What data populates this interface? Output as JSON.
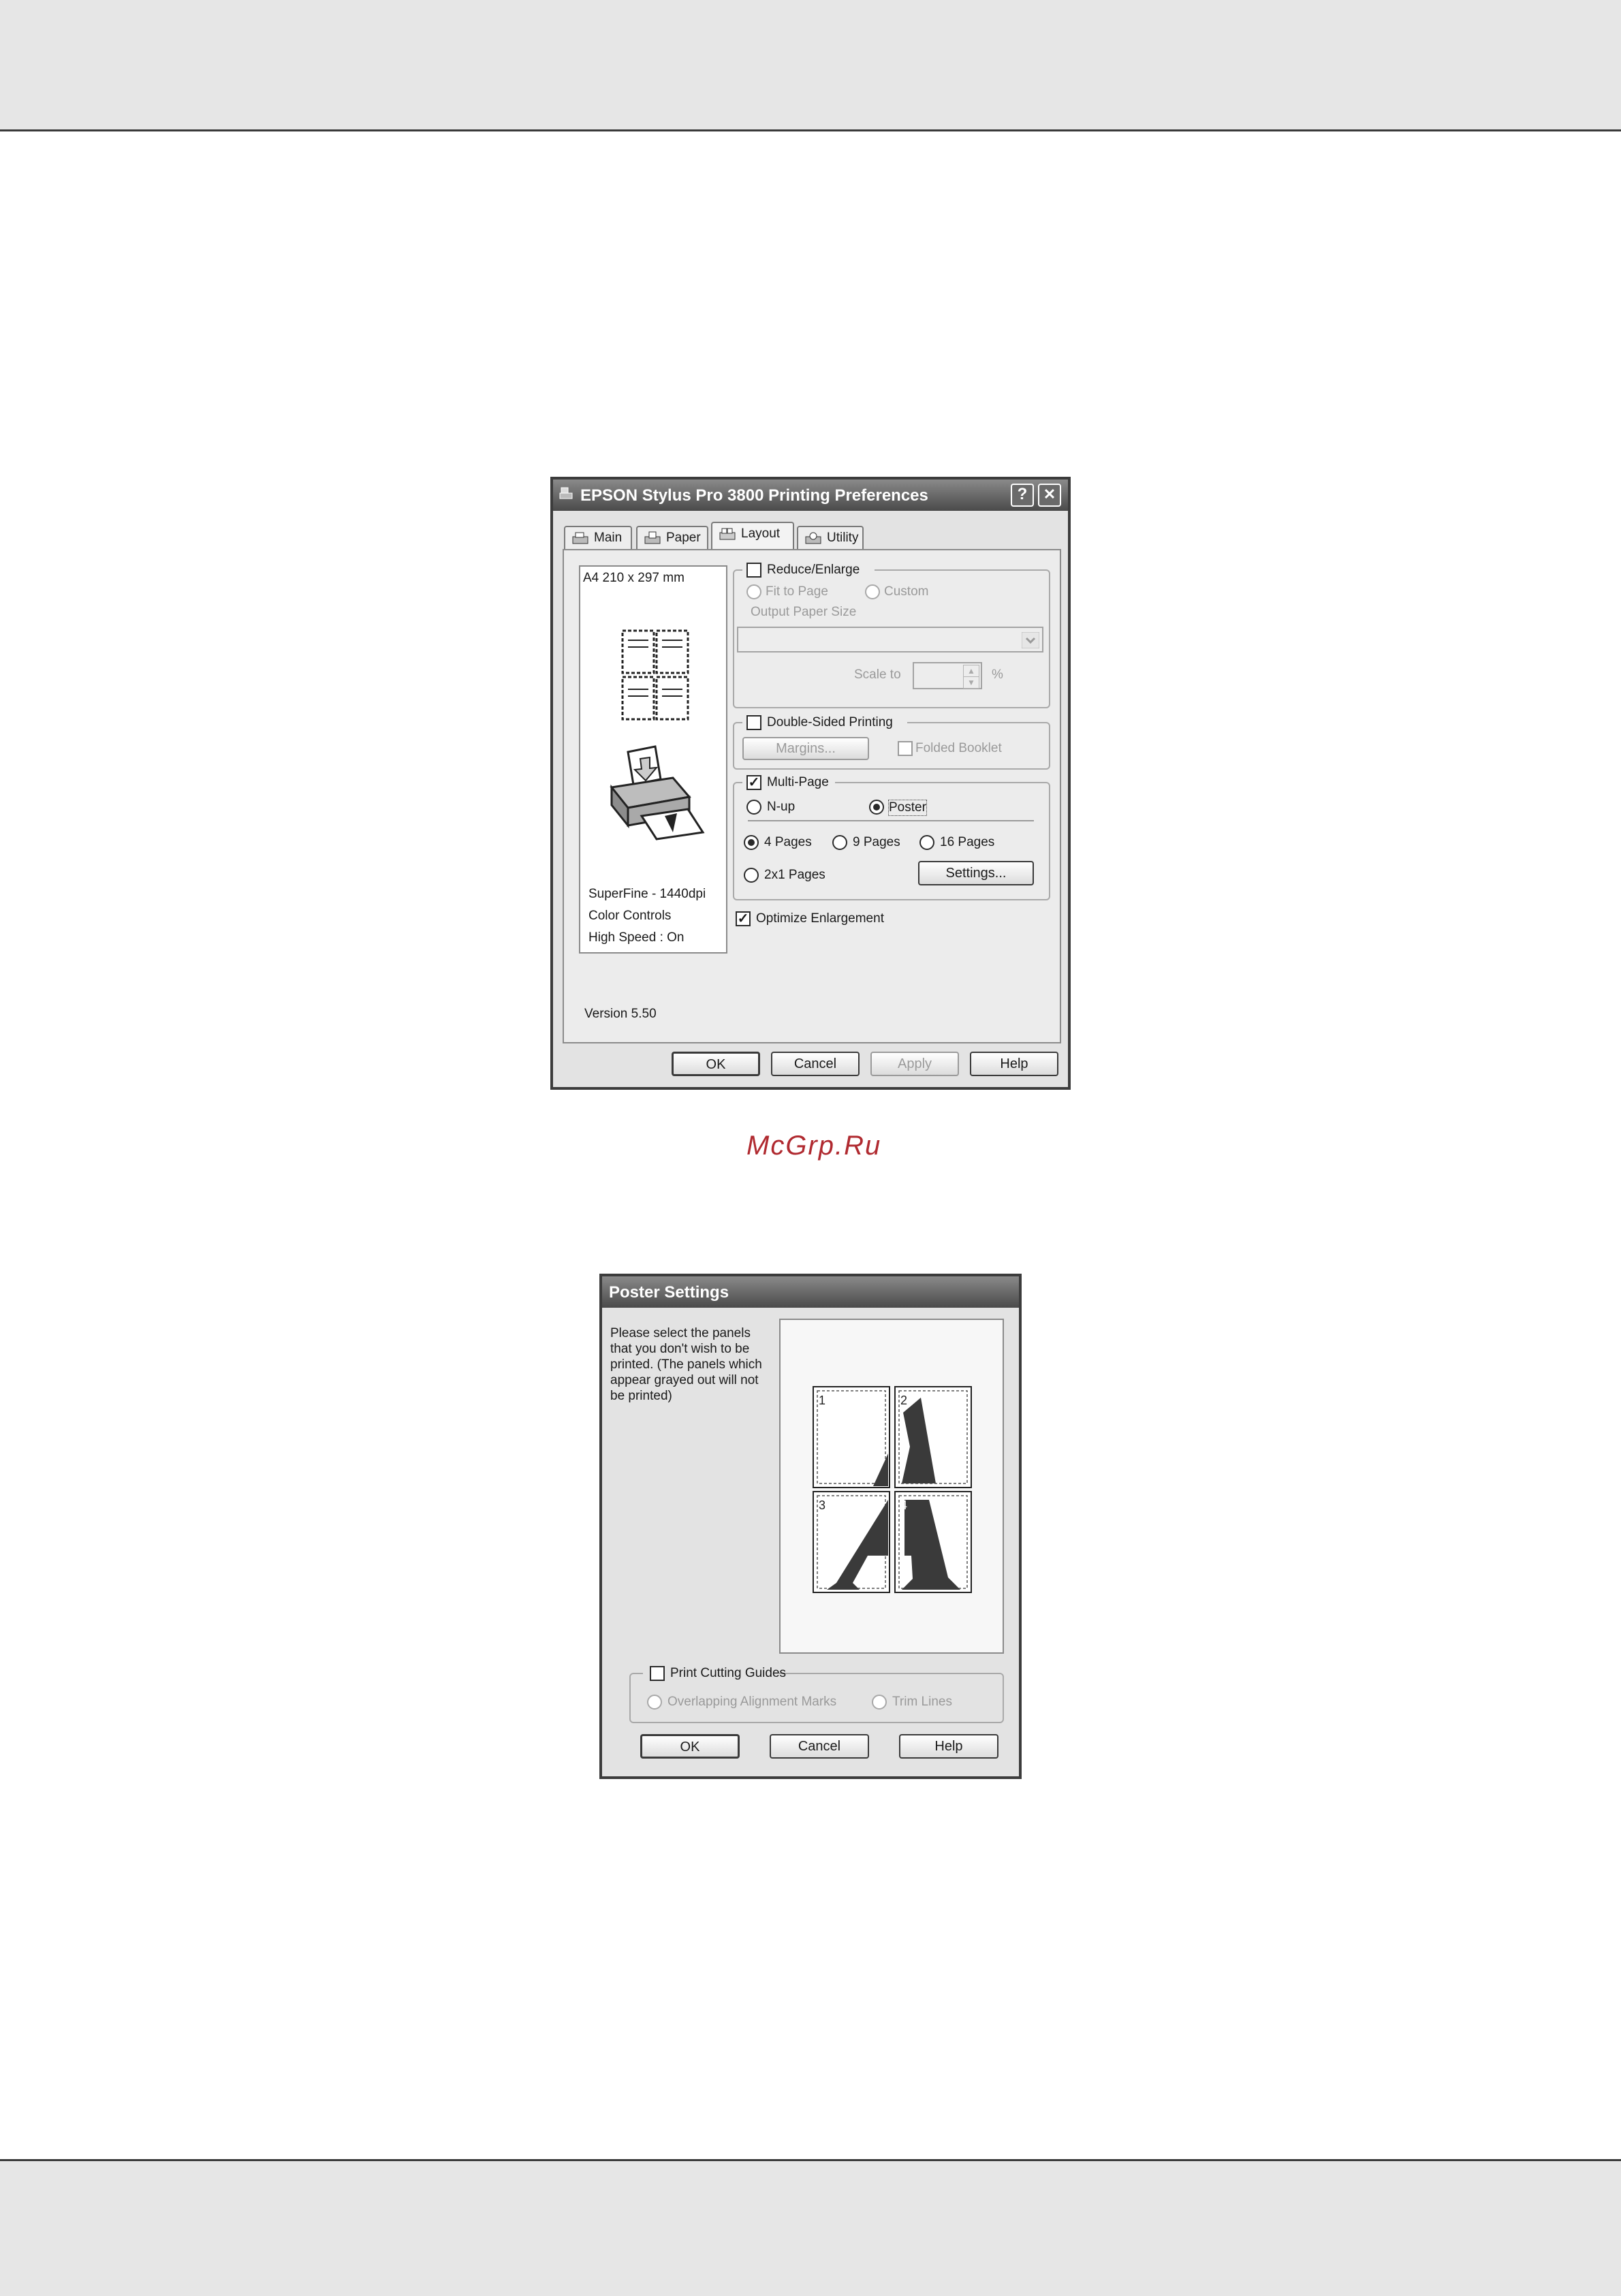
{
  "prefs": {
    "title": "EPSON Stylus Pro 3800 Printing Preferences",
    "help_btn": "?",
    "close_btn": "✕",
    "tabs": [
      "Main",
      "Paper",
      "Layout",
      "Utility"
    ],
    "paper_size": "A4 210 x 297 mm",
    "settings_summary": [
      "SuperFine - 1440dpi",
      "Color Controls",
      "High Speed : On"
    ],
    "version": "Version 5.50",
    "reduce_enlarge": "Reduce/Enlarge",
    "fit_to_page": "Fit to Page",
    "custom": "Custom",
    "output_paper_size": "Output Paper Size",
    "scale_to": "Scale to",
    "percent": "%",
    "double_sided": "Double-Sided Printing",
    "margins": "Margins...",
    "folded_booklet": "Folded Booklet",
    "multi_page": "Multi-Page",
    "multi_page_checked": "✓",
    "nup": "N-up",
    "poster": "Poster",
    "pages_4": "4 Pages",
    "pages_9": "9 Pages",
    "pages_16": "16 Pages",
    "pages_2x1": "2x1 Pages",
    "settings_btn": "Settings...",
    "optimize": "Optimize Enlargement",
    "optimize_checked": "✓",
    "ok": "OK",
    "cancel": "Cancel",
    "apply": "Apply",
    "help": "Help"
  },
  "watermark": "McGrp.Ru",
  "poster": {
    "title": "Poster Settings",
    "instructions": "Please select the panels that you don't wish to be printed. (The panels which appear grayed out will not be printed)",
    "instruction_lines": [
      "Please select the panels",
      "that you don't wish to be",
      "printed. (The panels which",
      "appear grayed out will not",
      "be printed)"
    ],
    "panel_numbers": [
      "1",
      "2",
      "3",
      "4"
    ],
    "print_cutting_guides": "Print Cutting Guides",
    "overlapping_marks": "Overlapping Alignment Marks",
    "trim_lines": "Trim Lines",
    "ok": "OK",
    "cancel": "Cancel",
    "help": "Help"
  }
}
